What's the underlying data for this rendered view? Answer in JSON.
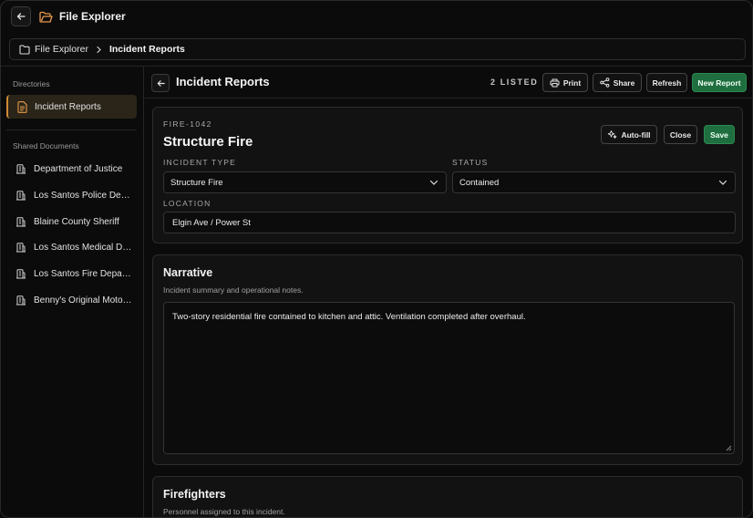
{
  "window": {
    "title": "File Explorer"
  },
  "breadcrumb": {
    "root": "File Explorer",
    "current": "Incident Reports"
  },
  "sidebar": {
    "directories_heading": "Directories",
    "directories": [
      {
        "label": "Incident Reports",
        "active": true
      }
    ],
    "shared_heading": "Shared Documents",
    "shared": [
      {
        "label": "Department of Justice"
      },
      {
        "label": "Los Santos Police Department"
      },
      {
        "label": "Blaine County Sheriff"
      },
      {
        "label": "Los Santos Medical Department"
      },
      {
        "label": "Los Santos Fire Department"
      },
      {
        "label": "Benny's Original Motor Works"
      }
    ]
  },
  "header": {
    "title": "Incident Reports",
    "listed": "2 LISTED",
    "print_label": "Print",
    "share_label": "Share",
    "refresh_label": "Refresh",
    "new_report_label": "New Report"
  },
  "record": {
    "id": "FIRE-1042",
    "title": "Structure Fire",
    "autofill_label": "Auto-fill",
    "close_label": "Close",
    "save_label": "Save",
    "incident_type_label": "INCIDENT TYPE",
    "incident_type_value": "Structure Fire",
    "status_label": "STATUS",
    "status_value": "Contained",
    "location_label": "LOCATION",
    "location_value": "Elgin Ave / Power St"
  },
  "narrative": {
    "title": "Narrative",
    "subtitle": "Incident summary and operational notes.",
    "text": "Two-story residential fire contained to kitchen and attic. Ventilation completed after overhaul."
  },
  "firefighters": {
    "title": "Firefighters",
    "subtitle": "Personnel assigned to this incident."
  },
  "colors": {
    "accent": "#d08a35",
    "save_green": "#1f6e3f",
    "background": "#0b0b0b"
  }
}
